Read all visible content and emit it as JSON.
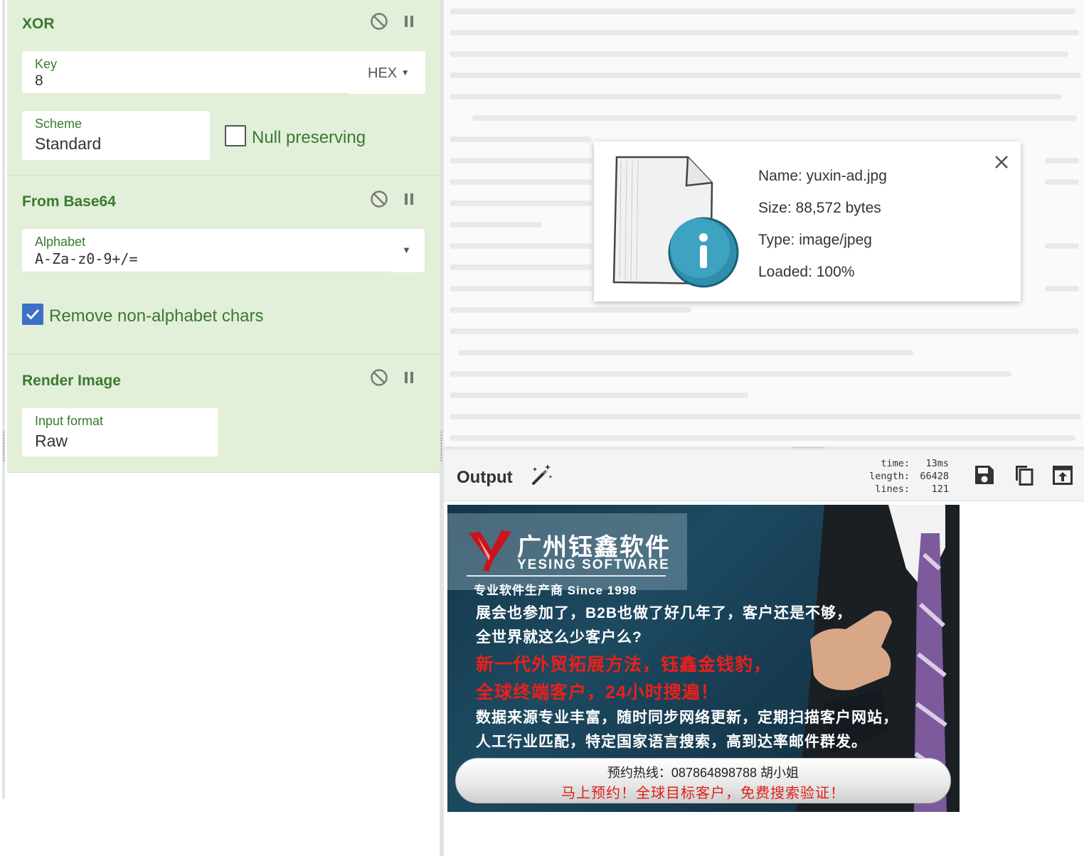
{
  "recipe": {
    "operations": [
      {
        "title": "XOR",
        "key": {
          "label": "Key",
          "value": "8",
          "format": "HEX"
        },
        "scheme": {
          "label": "Scheme",
          "value": "Standard"
        },
        "null_preserving": {
          "label": "Null preserving",
          "checked": false
        }
      },
      {
        "title": "From Base64",
        "alphabet": {
          "label": "Alphabet",
          "value": "A-Za-z0-9+/="
        },
        "remove_non_alphabet": {
          "label": "Remove non-alphabet chars",
          "checked": true
        }
      },
      {
        "title": "Render Image",
        "input_format": {
          "label": "Input format",
          "value": "Raw"
        }
      }
    ]
  },
  "file_details": {
    "name_line": "Name: yuxin-ad.jpg",
    "size_line": "Size: 88,572 bytes",
    "type_line": "Type: image/jpeg",
    "loaded_line": "Loaded: 100%"
  },
  "output": {
    "title": "Output",
    "stats": {
      "time_label": "time:",
      "time_value": "13ms",
      "length_label": "length:",
      "length_value": "66428",
      "lines_label": "lines:",
      "lines_value": "121"
    }
  },
  "rendered_image": {
    "company_cn": "广州钰鑫软件",
    "company_en": "YESING SOFTWARE",
    "tagline": "专业软件生产商  Since 1998",
    "line1": "展会也参加了，B2B也做了好几年了，客户还是不够，",
    "line2": "全世界就这么少客户么?",
    "line3": "新一代外贸拓展方法，钰鑫金钱豹，",
    "line4": "全球终端客户，24小时搜遍！",
    "line5": "数据来源专业丰富，随时同步网络更新，定期扫描客户网站，",
    "line6": "人工行业匹配，特定国家语言搜索，高到达率邮件群发。",
    "hotline": "预约热线：087864898788    胡小姐",
    "booking": "马上预约！全球目标客户，免费搜索验证！"
  },
  "colors": {
    "op_background": "#e2efd9",
    "op_title": "#3a7a30",
    "checkbox_checked": "#3c6fc8"
  }
}
